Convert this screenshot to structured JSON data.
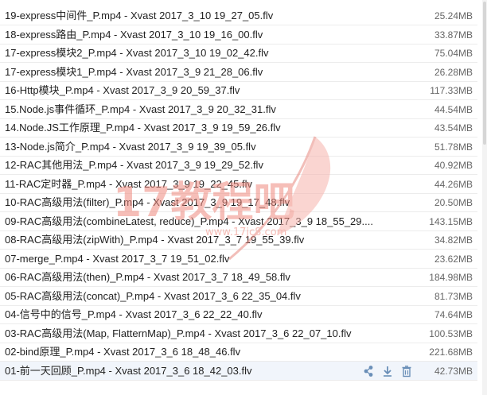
{
  "files": [
    {
      "name": "19-express中间件_P.mp4 - Xvast 2017_3_10 19_27_05.flv",
      "size": "25.24MB"
    },
    {
      "name": "18-express路由_P.mp4 - Xvast 2017_3_10 19_16_00.flv",
      "size": "33.87MB"
    },
    {
      "name": "17-express模块2_P.mp4 - Xvast 2017_3_10 19_02_42.flv",
      "size": "75.04MB"
    },
    {
      "name": "17-express模块1_P.mp4 - Xvast 2017_3_9 21_28_06.flv",
      "size": "26.28MB"
    },
    {
      "name": "16-Http模块_P.mp4 - Xvast 2017_3_9 20_59_37.flv",
      "size": "117.33MB"
    },
    {
      "name": "15.Node.js事件循环_P.mp4 - Xvast 2017_3_9 20_32_31.flv",
      "size": "44.54MB"
    },
    {
      "name": "14.Node.JS工作原理_P.mp4 - Xvast 2017_3_9 19_59_26.flv",
      "size": "43.54MB"
    },
    {
      "name": "13-Node.js简介_P.mp4 - Xvast 2017_3_9 19_39_05.flv",
      "size": "51.78MB"
    },
    {
      "name": "12-RAC其他用法_P.mp4 - Xvast 2017_3_9 19_29_52.flv",
      "size": "40.92MB"
    },
    {
      "name": "11-RAC定时器_P.mp4 - Xvast 2017_3_9 19_22_45.flv",
      "size": "44.26MB"
    },
    {
      "name": "10-RAC高级用法(filter)_P.mp4 - Xvast 2017_3_9 19_17_48.flv",
      "size": "20.50MB"
    },
    {
      "name": "09-RAC高级用法(combineLatest, reduce)_P.mp4 - Xvast 2017_3_9 18_55_29....",
      "size": "143.15MB"
    },
    {
      "name": "08-RAC高级用法(zipWith)_P.mp4 - Xvast 2017_3_7 19_55_39.flv",
      "size": "34.82MB"
    },
    {
      "name": "07-merge_P.mp4 - Xvast 2017_3_7 19_51_02.flv",
      "size": "23.62MB"
    },
    {
      "name": "06-RAC高级用法(then)_P.mp4 - Xvast 2017_3_7 18_49_58.flv",
      "size": "184.98MB"
    },
    {
      "name": "05-RAC高级用法(concat)_P.mp4 - Xvast 2017_3_6 22_35_04.flv",
      "size": "81.73MB"
    },
    {
      "name": "04-信号中的信号_P.mp4 - Xvast 2017_3_6 22_22_40.flv",
      "size": "74.64MB"
    },
    {
      "name": "03-RAC高级用法(Map, FlatternMap)_P.mp4 - Xvast 2017_3_6 22_07_10.flv",
      "size": "100.53MB"
    },
    {
      "name": "02-bind原理_P.mp4 - Xvast 2017_3_6 18_48_46.flv",
      "size": "221.68MB"
    },
    {
      "name": "01-前一天回顾_P.mp4 - Xvast 2017_3_6 18_42_03.flv",
      "size": "42.73MB"
    }
  ],
  "hover_actions": [
    "share-icon",
    "download-icon",
    "delete-icon"
  ],
  "watermark": {
    "text": "17教程吧",
    "url": "www.17jc8.com"
  },
  "colors": {
    "accent": "#4a8bd0",
    "watermark": "#f08a7f",
    "text": "#222222",
    "size_text": "#666666"
  }
}
